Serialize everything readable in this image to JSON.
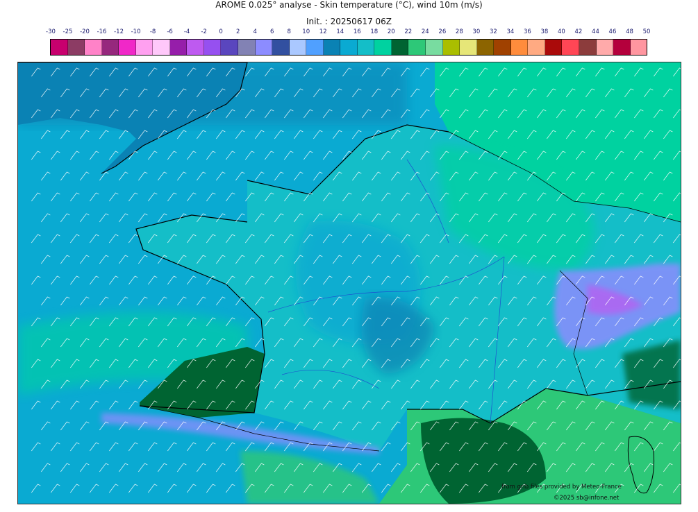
{
  "header": {
    "title": "AROME 0.025° analyse - Skin temperature (°C), wind 10m (m/s)",
    "init": "Init. : 20250617 06Z"
  },
  "legend": {
    "ticks": [
      "-30",
      "-25",
      "-20",
      "-16",
      "-12",
      "-10",
      "-8",
      "-6",
      "-4",
      "-2",
      "0",
      "2",
      "4",
      "6",
      "8",
      "10",
      "12",
      "14",
      "16",
      "18",
      "20",
      "22",
      "24",
      "26",
      "28",
      "30",
      "32",
      "34",
      "36",
      "38",
      "40",
      "42",
      "44",
      "46",
      "48",
      "50"
    ],
    "colors": [
      "#c8006e",
      "#8c3c64",
      "#ff82c8",
      "#96287d",
      "#f028c8",
      "#ffa0f0",
      "#ffc8fa",
      "#961eaa",
      "#be5af0",
      "#9650f0",
      "#5a46be",
      "#8282b4",
      "#8c8cff",
      "#3250a0",
      "#aac8ff",
      "#50a0ff",
      "#0a82b4",
      "#0aaad2",
      "#14bec8",
      "#00d2a0",
      "#006432",
      "#2dc878",
      "#78dca0",
      "#aabe00",
      "#e6e678",
      "#8c6400",
      "#a04100",
      "#ff8c3c",
      "#ffaa82",
      "#aa0a0a",
      "#ff4655",
      "#8c3c3c",
      "#ffaaaa",
      "#b4003c",
      "#ff96a0"
    ]
  },
  "map": {
    "region": "France",
    "dominant_colors": {
      "sea": "#0aaad2",
      "land_mild": "#14bec8",
      "land_warm": "#00d2a0",
      "hot_core": "#006432",
      "alps_cold": "#8c8cff"
    }
  },
  "footer": {
    "source": "from grib files provided by Meteo-France",
    "copyright": "©2025 sb@infone.net"
  }
}
